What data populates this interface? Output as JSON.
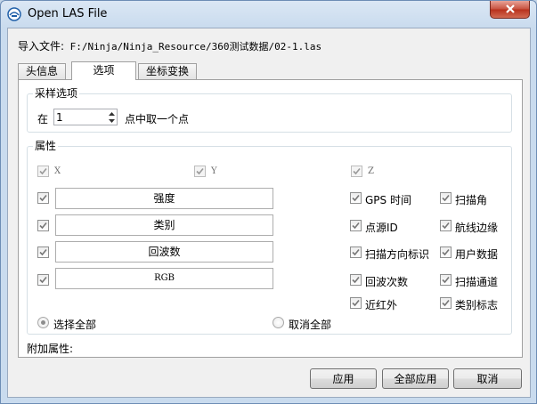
{
  "window": {
    "title": "Open LAS File"
  },
  "import_file": {
    "label": "导入文件:",
    "path": "F:/Ninja/Ninja_Resource/360测试数据/02-1.las"
  },
  "tabs": [
    {
      "label": "头信息"
    },
    {
      "label": "选项"
    },
    {
      "label": "坐标变换"
    }
  ],
  "sampling": {
    "title": "采样选项",
    "prefix": "在",
    "value": "1",
    "suffix": "点中取一个点"
  },
  "attributes": {
    "title": "属性",
    "xyz": [
      {
        "label": "X",
        "checked": true
      },
      {
        "label": "Y",
        "checked": true
      },
      {
        "label": "Z",
        "checked": true
      }
    ],
    "fields": [
      {
        "label": "强度"
      },
      {
        "label": "类别"
      },
      {
        "label": "回波数"
      },
      {
        "label": "RGB"
      }
    ],
    "col1": [
      {
        "label": "GPS 时间"
      },
      {
        "label": "点源ID"
      },
      {
        "label": "扫描方向标识"
      },
      {
        "label": "回波次数"
      },
      {
        "label": "近红外"
      }
    ],
    "col2": [
      {
        "label": "扫描角"
      },
      {
        "label": "航线边缘"
      },
      {
        "label": "用户数据"
      },
      {
        "label": "扫描通道"
      },
      {
        "label": "类别标志"
      }
    ],
    "select_all": "选择全部",
    "deselect_all": "取消全部"
  },
  "extra_attributes": {
    "label": "附加属性:"
  },
  "buttons": {
    "apply": "应用",
    "apply_all": "全部应用",
    "cancel": "取消"
  },
  "colors": {
    "accent": "#2a6fc9",
    "close": "#c7503d"
  }
}
